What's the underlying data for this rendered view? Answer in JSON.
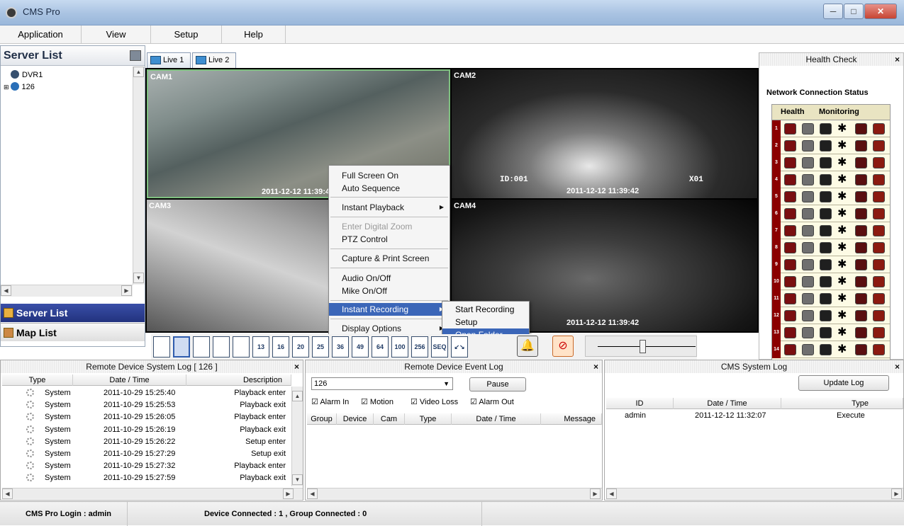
{
  "window": {
    "title": "CMS Pro",
    "minimize": "─",
    "maximize": "□",
    "close": "✕"
  },
  "menu": [
    {
      "label": "Application"
    },
    {
      "label": "View"
    },
    {
      "label": "Setup"
    },
    {
      "label": "Help"
    }
  ],
  "server_list": {
    "title": "Server List",
    "tree": [
      "DVR1",
      "126"
    ]
  },
  "nav": {
    "server": "Server List",
    "map": "Map List"
  },
  "tabs": [
    {
      "label": "Live 1"
    },
    {
      "label": "Live 2"
    }
  ],
  "cams": [
    {
      "label": "CAM1",
      "time": "2011-12-12 11:39:42"
    },
    {
      "label": "CAM2",
      "time": "2011-12-12 11:39:42",
      "osd_left": "ID:001",
      "osd_right": "X01"
    },
    {
      "label": "CAM3",
      "time": ""
    },
    {
      "label": "CAM4",
      "time": "2011-12-12 11:39:42"
    }
  ],
  "context_menu": [
    "Full Screen On",
    "Auto Sequence",
    "Instant Playback",
    "Enter Digital Zoom",
    "PTZ Control",
    "Capture & Print Screen",
    "Audio On/Off",
    "Mike On/Off",
    "Instant Recording",
    "Display Options"
  ],
  "submenu": [
    "Start Recording",
    "Setup",
    "Open Folder"
  ],
  "layout_buttons": [
    "",
    "",
    "",
    "",
    "",
    "13",
    "16",
    "20",
    "25",
    "36",
    "49",
    "64",
    "100",
    "256",
    "SEQ",
    "↙↘"
  ],
  "health": {
    "title": "Health Check",
    "section": "Network Connection Status",
    "col_health": "Health",
    "col_monitoring": "Monitoring",
    "rows": [
      "1",
      "2",
      "3",
      "4",
      "5",
      "6",
      "7",
      "8",
      "9",
      "10",
      "11",
      "12",
      "13",
      "14"
    ]
  },
  "remote_log": {
    "title": "Remote Device System Log  [ 126 ]",
    "columns": [
      "Type",
      "Date / Time",
      "Description"
    ],
    "rows": [
      {
        "type": "System",
        "time": "2011-10-29 15:25:40",
        "desc": "Playback enter"
      },
      {
        "type": "System",
        "time": "2011-10-29 15:25:53",
        "desc": "Playback exit"
      },
      {
        "type": "System",
        "time": "2011-10-29 15:26:05",
        "desc": "Playback enter"
      },
      {
        "type": "System",
        "time": "2011-10-29 15:26:19",
        "desc": "Playback exit"
      },
      {
        "type": "System",
        "time": "2011-10-29 15:26:22",
        "desc": "Setup enter"
      },
      {
        "type": "System",
        "time": "2011-10-29 15:27:29",
        "desc": "Setup exit"
      },
      {
        "type": "System",
        "time": "2011-10-29 15:27:32",
        "desc": "Playback enter"
      },
      {
        "type": "System",
        "time": "2011-10-29 15:27:59",
        "desc": "Playback exit"
      }
    ]
  },
  "event_log": {
    "title": "Remote Device Event Log",
    "device": "126",
    "pause": "Pause",
    "filters": [
      "Alarm In",
      "Motion",
      "Video Loss",
      "Alarm Out"
    ],
    "columns": [
      "Group",
      "Device",
      "Cam",
      "Type",
      "Date / Time",
      "Message"
    ]
  },
  "cms_log": {
    "title": "CMS System Log",
    "update": "Update Log",
    "columns": [
      "ID",
      "Date / Time",
      "Type"
    ],
    "rows": [
      {
        "id": "admin",
        "time": "2011-12-12 11:32:07",
        "type": "Execute"
      }
    ]
  },
  "status": {
    "login": "CMS Pro Login : admin",
    "connected": "Device Connected : 1 , Group Connected : 0"
  }
}
